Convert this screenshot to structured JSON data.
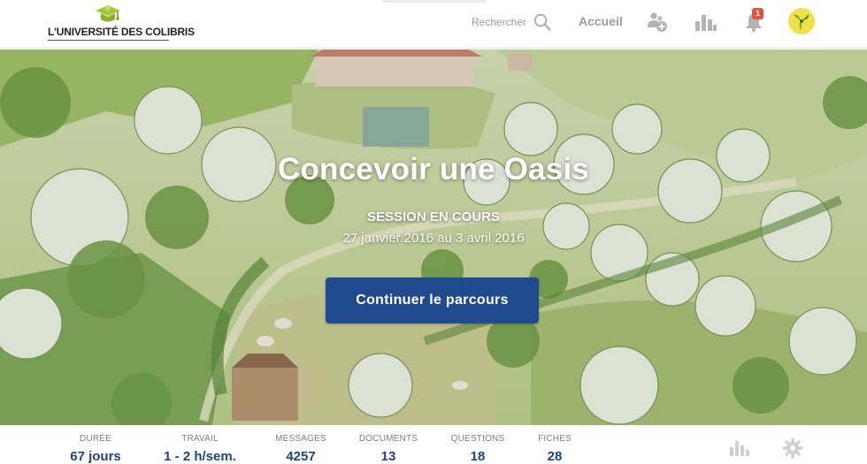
{
  "brand": {
    "logo_text": "L'UNIVERSITÉ DES COLIBRIS",
    "accent_color": "#a6c53a"
  },
  "header": {
    "search_label": "Rechercher",
    "nav_home": "Accueil",
    "icons": [
      "search-icon",
      "users-add-icon",
      "stats-icon",
      "bell-icon",
      "avatar"
    ],
    "notification_count": "1"
  },
  "hero": {
    "title": "Concevoir une Oasis",
    "status": "SESSION EN COURS",
    "dates": "27 janvier 2016 au 3 avril 2016",
    "cta_label": "Continuer le parcours",
    "cta_color": "#1f4a8e"
  },
  "stats": {
    "items": [
      {
        "label": "DURÉE",
        "value": "67 jours"
      },
      {
        "label": "TRAVAIL",
        "value": "1 - 2 h/sem."
      },
      {
        "label": "MESSAGES",
        "value": "4257"
      },
      {
        "label": "DOCUMENTS",
        "value": "13"
      },
      {
        "label": "QUESTIONS",
        "value": "18"
      },
      {
        "label": "FICHES",
        "value": "28"
      }
    ],
    "value_color": "#1e4284",
    "icons": [
      "stats-icon",
      "gear-icon"
    ]
  }
}
